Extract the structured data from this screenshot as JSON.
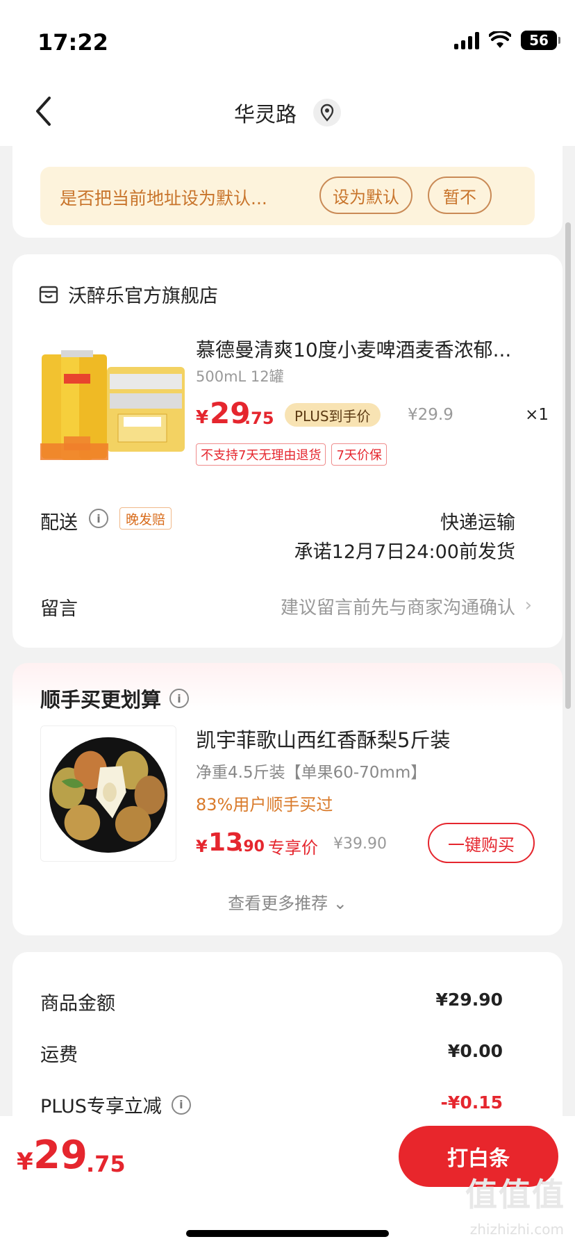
{
  "status_bar": {
    "time": "17:22",
    "battery": "56"
  },
  "nav": {
    "title": "华灵路"
  },
  "address_banner": {
    "text": "是否把当前地址设为默认...",
    "set_default": "设为默认",
    "not_now": "暂不"
  },
  "order": {
    "store_name": "沃醉乐官方旗舰店",
    "product": {
      "title": "慕德曼清爽10度小麦啤酒麦香浓郁...",
      "spec": "500mL 12罐",
      "price_symbol": "¥",
      "price_int": "29",
      "price_dec": ".75",
      "plus_badge": "PLUS到手价",
      "original_price": "¥29.9",
      "quantity": "×1",
      "tags": [
        "不支持7天无理由退货",
        "7天价保"
      ]
    },
    "delivery": {
      "label": "配送",
      "late_badge": "晚发赔",
      "mode": "快递运输",
      "promise": "承诺12月7日24:00前发货"
    },
    "note": {
      "label": "留言",
      "hint": "建议留言前先与商家沟通确认",
      "chevron": "›"
    }
  },
  "recommend": {
    "title": "顺手买更划算",
    "item": {
      "name": "凯宇菲歌山西红香酥梨5斤装",
      "spec": "净重4.5斤装【单果60-70mm】",
      "social": "83%用户顺手买过",
      "price_symbol": "¥",
      "price_int": "13",
      "price_dec": ".90",
      "price_label": "专享价",
      "original_price": "¥39.90",
      "buy_button": "一键购买"
    },
    "more": "查看更多推荐 ⌄"
  },
  "summary": {
    "rows": [
      {
        "label": "商品金额",
        "value": "¥29.90"
      },
      {
        "label": "运费",
        "value": "¥0.00"
      },
      {
        "label": "PLUS专享立减",
        "value": "-¥0.15"
      }
    ]
  },
  "bottom": {
    "total_symbol": "¥",
    "total_int": "29",
    "total_dec": ".75",
    "pay_button": "打白条"
  },
  "watermark": {
    "main": "值值值",
    "sub": "zhizhizhi.com"
  },
  "colors": {
    "accent": "#e5262e",
    "banner_bg": "#fdf3dc",
    "banner_text": "#c8742b",
    "plus_badge": "#f8e3b3"
  }
}
